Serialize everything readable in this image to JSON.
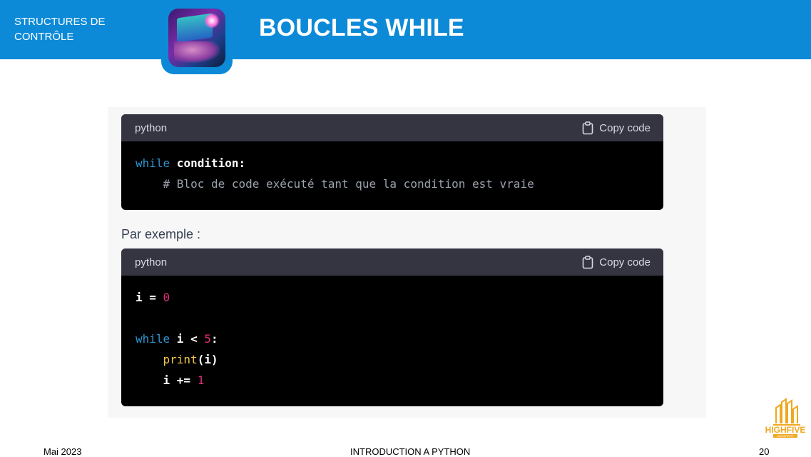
{
  "header": {
    "section_label": "STRUCTURES DE CONTRÔLE",
    "title": "BOUCLES WHILE"
  },
  "code_block_1": {
    "language": "python",
    "copy_label": "Copy code",
    "lines": [
      {
        "keyword": "while",
        "rest": " condition:"
      },
      {
        "comment": "    # Bloc de code exécuté tant que la condition est vraie"
      }
    ]
  },
  "example_label": "Par exemple :",
  "code_block_2": {
    "language": "python",
    "copy_label": "Copy code",
    "line1_var": "i = ",
    "line1_num": "0",
    "line3_kw": "while",
    "line3_rest": " i < ",
    "line3_num": "5",
    "line3_end": ":",
    "line4_fn": "print",
    "line4_rest": "(i)",
    "line5_rest": "    i += ",
    "line5_num": "1"
  },
  "footer": {
    "date": "Mai 2023",
    "course": "INTRODUCTION A PYTHON",
    "page_number": "20"
  },
  "logo": {
    "text": "HIGHFIVE",
    "subtext": "UNIVERSITY",
    "color": "#f0a820"
  },
  "colors": {
    "header_bg": "#0c8ad8",
    "code_keyword": "#2e95d3",
    "code_number": "#df3079",
    "code_function": "#f2c94c"
  }
}
